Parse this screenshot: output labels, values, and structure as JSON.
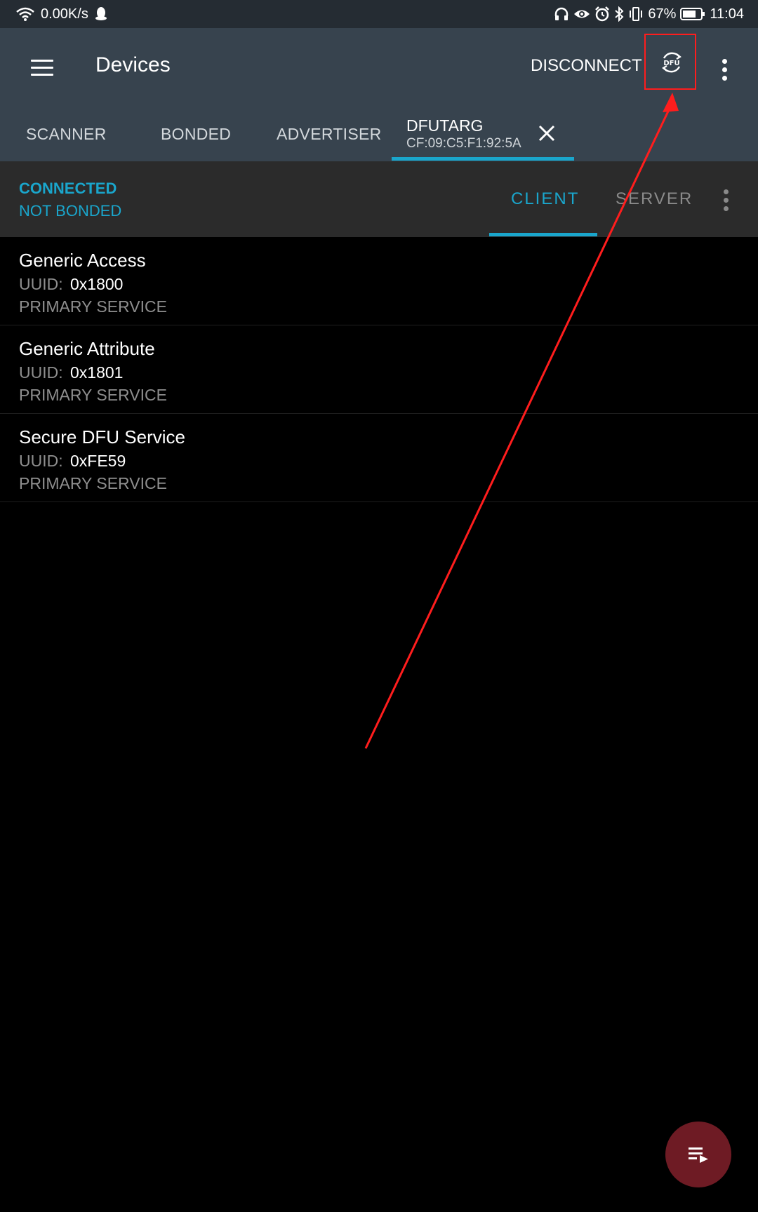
{
  "status_bar": {
    "speed": "0.00K/s",
    "battery": "67%",
    "time": "11:04",
    "icons": [
      "wifi-icon",
      "qq-icon",
      "headphones-icon",
      "eye-icon",
      "alarm-icon",
      "bluetooth-icon",
      "vibrate-icon",
      "battery-icon"
    ]
  },
  "app_bar": {
    "title": "Devices",
    "disconnect_label": "DISCONNECT",
    "dfu_icon": "dfu-icon",
    "dfu_icon_text": "DFU",
    "annotation_color": "#ff1d1d"
  },
  "tabs": {
    "items": [
      {
        "label": "SCANNER"
      },
      {
        "label": "BONDED"
      },
      {
        "label": "ADVERTISER"
      }
    ],
    "device": {
      "name": "DFUTARG",
      "mac": "CF:09:C5:F1:92:5A"
    },
    "accent": "#1aa6cc"
  },
  "connection": {
    "status": "CONNECTED",
    "bond_status": "NOT BONDED",
    "subtabs": [
      {
        "label": "CLIENT",
        "active": true
      },
      {
        "label": "SERVER",
        "active": false
      }
    ]
  },
  "services": [
    {
      "name": "Generic Access",
      "uuid_label": "UUID:",
      "uuid": "0x1800",
      "type": "PRIMARY SERVICE"
    },
    {
      "name": "Generic Attribute",
      "uuid_label": "UUID:",
      "uuid": "0x1801",
      "type": "PRIMARY SERVICE"
    },
    {
      "name": "Secure DFU Service",
      "uuid_label": "UUID:",
      "uuid": "0xFE59",
      "type": "PRIMARY SERVICE"
    }
  ],
  "fab": {
    "icon": "log-list-icon",
    "color": "#6e1b24"
  }
}
